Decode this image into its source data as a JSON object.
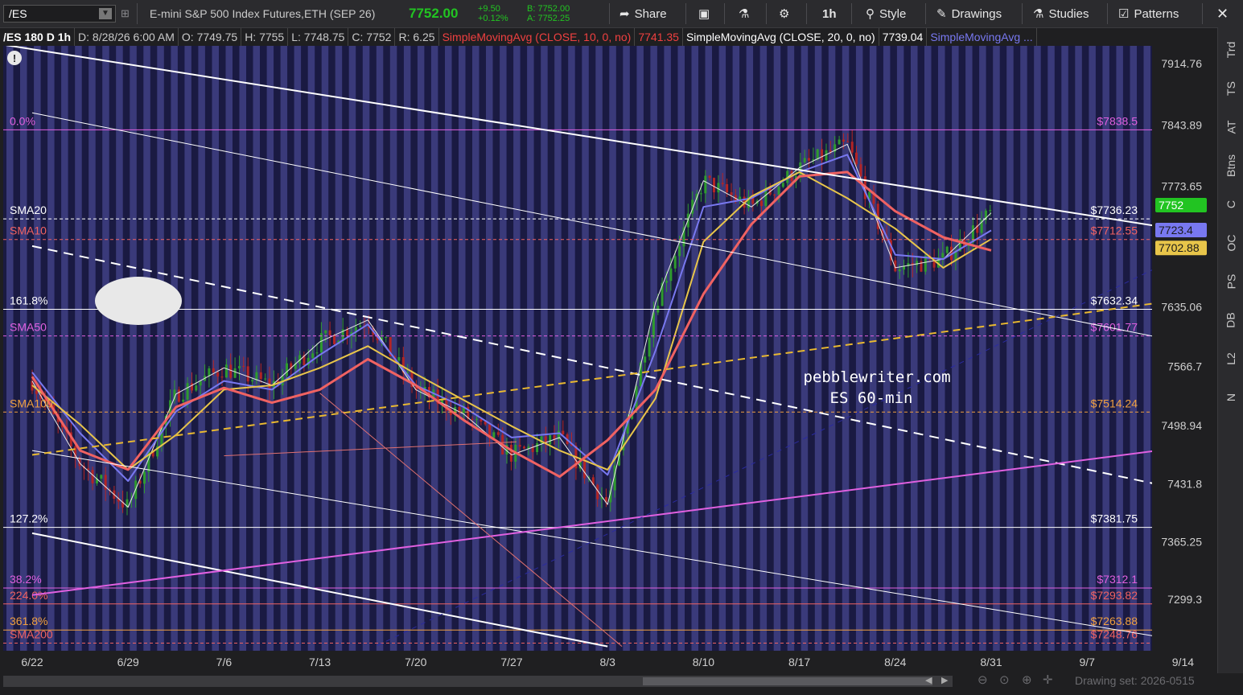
{
  "toolbar": {
    "symbol": "/ES",
    "title": "E-mini S&P 500 Index Futures,ETH (SEP 26)",
    "last_price": "7752.00",
    "change": "+9.50",
    "change_pct": "+0.12%",
    "bid": "B: 7752.00",
    "ask": "A: 7752.25",
    "share": "Share",
    "timeframe": "1h",
    "style": "Style",
    "drawings": "Drawings",
    "studies": "Studies",
    "patterns": "Patterns"
  },
  "infobar": {
    "symbol_info": "/ES 180 D 1h",
    "date": "D: 8/28/26 6:00 AM",
    "open": "O: 7749.75",
    "high": "H: 7755",
    "low": "L: 7748.75",
    "close": "C: 7752",
    "range": "R: 6.25",
    "sma10": "SimpleMovingAvg (CLOSE, 10, 0, no)",
    "sma10_val": "7741.35",
    "sma20": "SimpleMovingAvg (CLOSE, 20, 0, no)",
    "sma20_val": "7739.04",
    "sma_more": "SimpleMovingAvg ..."
  },
  "right_tabs": [
    "Trd",
    "TS",
    "AT",
    "Btns",
    "C",
    "OC",
    "PS",
    "DB",
    "L2",
    "N"
  ],
  "drawing_set": "Drawing set: 2026-0515",
  "colors": {
    "background": "#1a1a42",
    "stripe": "#3a3a7a",
    "candle_up": "#2e9b2e",
    "candle_down": "#b32424",
    "sma10": "#f06262",
    "sma20": "#e8c54a",
    "sma50": "#7878f0",
    "fast_avg": "#e8e8e8",
    "fib_magenta": "#e060e0",
    "label_magenta": "#e070e0",
    "label_orange": "#f0a040"
  },
  "chart_data": {
    "type": "candlestick",
    "title": "pebblewriter.com",
    "subtitle": "ES 60-min",
    "x_tick_labels": [
      "6/22",
      "6/29",
      "7/6",
      "7/13",
      "7/20",
      "7/27",
      "8/3",
      "8/10",
      "8/17",
      "8/24",
      "8/31",
      "9/7",
      "9/14"
    ],
    "y_tick_labels": [
      "7914.76",
      "7843.89",
      "7773.65",
      "7635.06",
      "7566.7",
      "7498.94",
      "7431.8",
      "7365.25",
      "7299.3"
    ],
    "ylim": [
      7240,
      7935
    ],
    "price_tags": [
      {
        "label": "7752",
        "value": 7752,
        "color": "#22c422"
      },
      {
        "label": "7723.4",
        "value": 7723.4,
        "color": "#7878f0"
      },
      {
        "label": "7702.88",
        "value": 7702.88,
        "color": "#e8c54a"
      }
    ],
    "horizontal_levels": [
      {
        "left_label": "0.0%",
        "right_label": "$7838.5",
        "value": 7838.5,
        "color": "#e060e0",
        "style": "solid"
      },
      {
        "left_label": "SMA20",
        "right_label": "$7736.23",
        "value": 7736.23,
        "color": "#ffffff",
        "style": "dashed"
      },
      {
        "left_label": "SMA10",
        "right_label": "$7712.55",
        "value": 7712.55,
        "color": "#f06262",
        "style": "dashed"
      },
      {
        "left_label": "161.8%",
        "right_label": "$7632.34",
        "value": 7632.34,
        "color": "#ffffff",
        "style": "solid"
      },
      {
        "left_label": "SMA50",
        "right_label": "$7601.77",
        "value": 7601.77,
        "color": "#e060e0",
        "style": "dashed"
      },
      {
        "left_label": "SMA100",
        "right_label": "$7514.24",
        "value": 7514.24,
        "color": "#f0a040",
        "style": "dashed"
      },
      {
        "left_label": "127.2%",
        "right_label": "$7381.75",
        "value": 7381.75,
        "color": "#ffffff",
        "style": "solid"
      },
      {
        "left_label": "38.2%",
        "right_label": "$7312.1",
        "value": 7312.1,
        "color": "#e060e0",
        "style": "solid"
      },
      {
        "left_label": "224.0%",
        "right_label": "$7293.82",
        "value": 7293.82,
        "color": "#f06262",
        "style": "solid"
      },
      {
        "left_label": "361.8%",
        "right_label": "$7263.88",
        "value": 7263.88,
        "color": "#f0a040",
        "style": "solid"
      },
      {
        "left_label": "SMA200",
        "right_label": "$7248.76",
        "value": 7248.76,
        "color": "#f06262",
        "style": "dashed"
      }
    ],
    "trend_lines": [
      {
        "name": "upper-white-channel",
        "color": "#ffffff",
        "width": 2,
        "dash": "",
        "p1": [
          -0.8,
          7945
        ],
        "p2": [
          12.3,
          7718
        ]
      },
      {
        "name": "thin-white-channel-1",
        "color": "#ffffff",
        "width": 1,
        "dash": "",
        "p1": [
          0.0,
          7858
        ],
        "p2": [
          12.3,
          7588
        ]
      },
      {
        "name": "thin-white-channel-2",
        "color": "#ffffff",
        "width": 1,
        "dash": "",
        "p1": [
          0.0,
          7470
        ],
        "p2": [
          12.3,
          7246
        ]
      },
      {
        "name": "lower-white-channel",
        "color": "#ffffff",
        "width": 2,
        "dash": "",
        "p1": [
          0.0,
          7375
        ],
        "p2": [
          6.0,
          7245
        ]
      },
      {
        "name": "white-dashed-channel",
        "color": "#ffffff",
        "width": 2,
        "dash": "12,8",
        "p1": [
          0.0,
          7705
        ],
        "p2": [
          12.3,
          7418
        ]
      },
      {
        "name": "yellow-dashed-support",
        "color": "#e8b830",
        "width": 2,
        "dash": "9,6",
        "p1": [
          0.0,
          7465
        ],
        "p2": [
          12.3,
          7648
        ]
      },
      {
        "name": "magenta-rising-support",
        "color": "#e060e0",
        "width": 2,
        "dash": "",
        "p1": [
          0.0,
          7304
        ],
        "p2": [
          12.3,
          7478
        ]
      },
      {
        "name": "navy-dashed-rising",
        "color": "#2a2aa0",
        "width": 1,
        "dash": "6,6",
        "p1": [
          3.6,
          7246
        ],
        "p2": [
          12.1,
          7700
        ]
      },
      {
        "name": "thin-red-diagonal",
        "color": "#e07070",
        "width": 1,
        "dash": "",
        "p1": [
          3.0,
          7536
        ],
        "p2": [
          6.15,
          7245
        ]
      },
      {
        "name": "thin-red-flat",
        "color": "#e07070",
        "width": 1,
        "dash": "",
        "p1": [
          2.0,
          7464
        ],
        "p2": [
          5.05,
          7480
        ]
      }
    ],
    "sma10": [
      [
        0,
        7555
      ],
      [
        0.5,
        7470
      ],
      [
        1,
        7448
      ],
      [
        1.5,
        7520
      ],
      [
        2,
        7542
      ],
      [
        2.5,
        7525
      ],
      [
        3,
        7540
      ],
      [
        3.5,
        7575
      ],
      [
        4,
        7545
      ],
      [
        4.5,
        7505
      ],
      [
        5,
        7470
      ],
      [
        5.5,
        7440
      ],
      [
        6,
        7482
      ],
      [
        6.5,
        7540
      ],
      [
        7,
        7650
      ],
      [
        7.5,
        7730
      ],
      [
        8,
        7785
      ],
      [
        8.5,
        7790
      ],
      [
        9,
        7745
      ],
      [
        9.5,
        7715
      ],
      [
        10,
        7700
      ]
    ],
    "sma20": [
      [
        0,
        7545
      ],
      [
        0.5,
        7500
      ],
      [
        1,
        7448
      ],
      [
        1.5,
        7488
      ],
      [
        2,
        7540
      ],
      [
        2.5,
        7545
      ],
      [
        3,
        7565
      ],
      [
        3.5,
        7590
      ],
      [
        4,
        7558
      ],
      [
        4.5,
        7528
      ],
      [
        5,
        7498
      ],
      [
        5.5,
        7470
      ],
      [
        6,
        7448
      ],
      [
        6.5,
        7530
      ],
      [
        7,
        7710
      ],
      [
        7.5,
        7762
      ],
      [
        8,
        7790
      ],
      [
        8.5,
        7760
      ],
      [
        9,
        7725
      ],
      [
        9.5,
        7680
      ],
      [
        10,
        7713
      ]
    ],
    "sma50": [
      [
        0,
        7560
      ],
      [
        0.5,
        7490
      ],
      [
        1,
        7435
      ],
      [
        1.5,
        7515
      ],
      [
        2,
        7550
      ],
      [
        2.5,
        7540
      ],
      [
        3,
        7580
      ],
      [
        3.5,
        7615
      ],
      [
        4,
        7545
      ],
      [
        4.5,
        7520
      ],
      [
        5,
        7485
      ],
      [
        5.5,
        7490
      ],
      [
        6,
        7442
      ],
      [
        6.5,
        7585
      ],
      [
        7,
        7750
      ],
      [
        7.5,
        7760
      ],
      [
        8,
        7790
      ],
      [
        8.5,
        7810
      ],
      [
        9,
        7695
      ],
      [
        9.5,
        7690
      ],
      [
        10,
        7723
      ]
    ],
    "fast_avg": [
      [
        0,
        7550
      ],
      [
        0.5,
        7455
      ],
      [
        1,
        7405
      ],
      [
        1.5,
        7535
      ],
      [
        2,
        7565
      ],
      [
        2.5,
        7545
      ],
      [
        3,
        7595
      ],
      [
        3.5,
        7620
      ],
      [
        4,
        7540
      ],
      [
        4.5,
        7512
      ],
      [
        5,
        7465
      ],
      [
        5.5,
        7485
      ],
      [
        6,
        7408
      ],
      [
        6.5,
        7640
      ],
      [
        7,
        7780
      ],
      [
        7.5,
        7750
      ],
      [
        8,
        7795
      ],
      [
        8.5,
        7822
      ],
      [
        9,
        7680
      ],
      [
        9.5,
        7690
      ],
      [
        10,
        7743
      ]
    ]
  }
}
